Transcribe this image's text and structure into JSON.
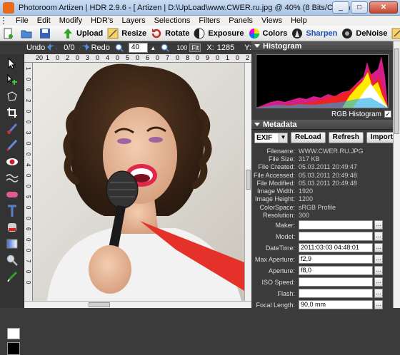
{
  "window": {
    "title": "Photoroom Artizen | HDR 2.9.6 - [  Artizen | D:\\UpLoad\\www.CWER.ru.jpg @ 40% (8 Bits/Channel RGBA)]",
    "minimize": "_",
    "maximize": "□",
    "close": "✕"
  },
  "menu": [
    "File",
    "Edit",
    "Modify",
    "HDR's",
    "Layers",
    "Selections",
    "Filters",
    "Panels",
    "Views",
    "Help"
  ],
  "toolbar": {
    "upload": "Upload",
    "resize": "Resize",
    "rotate": "Rotate",
    "exposure": "Exposure",
    "colors": "Colors",
    "sharpen": "Sharpen",
    "denoise": "DeNoise",
    "more": "H"
  },
  "toolbar2": {
    "undo": "Undo",
    "undo_count": "0/0",
    "redo": "Redo",
    "zoom_value": "40",
    "zoom_fit": "100",
    "fit_label": "Fit",
    "x_label": "X:",
    "x_value": "1285",
    "y_label": "Y:"
  },
  "ruler": {
    "top": [
      "20",
      "1",
      "0",
      "2",
      "0",
      "3",
      "0",
      "4",
      "0",
      "5",
      "0",
      "6",
      "0",
      "7",
      "0",
      "8",
      "0",
      "9",
      "0",
      "1",
      "0",
      "2"
    ],
    "left": [
      "1",
      "0",
      "0",
      "2",
      "0",
      "0",
      "3",
      "0",
      "0",
      "4",
      "0",
      "0",
      "5",
      "0",
      "0",
      "6",
      "0",
      "0",
      "7",
      "0",
      "0"
    ]
  },
  "histogram": {
    "title": "Histogram",
    "mode_label": "RGB Histogram",
    "checked": "✓"
  },
  "metadata": {
    "title": "Metadata",
    "select": "EXIF",
    "reload": "ReLoad",
    "refresh": "Refresh",
    "import": "Import",
    "rows": [
      {
        "label": "Filename:",
        "value": "WWW.CWER.RU.JPG"
      },
      {
        "label": "File Size:",
        "value": "317 KB"
      },
      {
        "label": "File Created:",
        "value": "05.03.2011 20:49:47"
      },
      {
        "label": "File Accessed:",
        "value": "05.03.2011 20:49:48"
      },
      {
        "label": "File Modified:",
        "value": "05.03.2011 20:49:48"
      },
      {
        "label": "Image Width:",
        "value": "1920"
      },
      {
        "label": "Image Height:",
        "value": "1200"
      },
      {
        "label": "ColorSpace:",
        "value": "sRGB Profile"
      },
      {
        "label": "Resolution:",
        "value": "300"
      }
    ],
    "fields": [
      {
        "label": "Maker:",
        "value": ""
      },
      {
        "label": "Model:",
        "value": ""
      },
      {
        "label": "DateTime:",
        "value": "2011:03:03 04:48:01"
      },
      {
        "label": "Max Aperture:",
        "value": "f2,9"
      },
      {
        "label": "Aperture:",
        "value": "f8,0"
      },
      {
        "label": "ISO Speed:",
        "value": ""
      },
      {
        "label": "Flash:",
        "value": ""
      },
      {
        "label": "Focal Length:",
        "value": "90,0 mm"
      }
    ],
    "dots": "..."
  }
}
